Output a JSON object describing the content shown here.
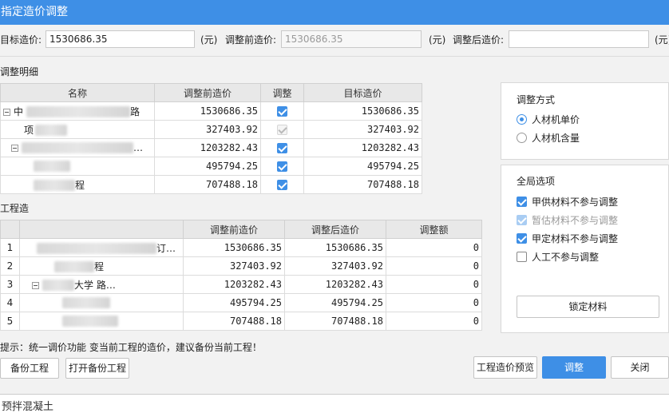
{
  "window": {
    "title": "指定造价调整"
  },
  "top": {
    "target_label": "目标造价:",
    "target_value": "1530686.35",
    "unit": "(元)",
    "before_label": "调整前造价:",
    "before_value": "1530686.35",
    "after_label": "调整后造价:",
    "after_value": ""
  },
  "detail": {
    "label": "调整明细",
    "headers": [
      "名称",
      "调整前造价",
      "调整",
      "目标造价"
    ],
    "rows": [
      {
        "name": "中",
        "name_tail": "路",
        "before": "1530686.35",
        "adjust": "on",
        "target": "1530686.35"
      },
      {
        "name": "项",
        "name_tail": "",
        "before": "327403.92",
        "adjust": "disabled",
        "target": "327403.92"
      },
      {
        "name": "",
        "name_tail": "…",
        "before": "1203282.43",
        "adjust": "on",
        "target": "1203282.43"
      },
      {
        "name": "",
        "name_tail": "",
        "before": "495794.25",
        "adjust": "on",
        "target": "495794.25"
      },
      {
        "name": "",
        "name_tail": "程",
        "before": "707488.18",
        "adjust": "on",
        "target": "707488.18"
      }
    ]
  },
  "project": {
    "label": "工程造",
    "headers": [
      "",
      "调整前造价",
      "调整后造价",
      "调整额"
    ],
    "rows": [
      {
        "num": "1",
        "name_tail": "订…",
        "before": "1530686.35",
        "after": "1530686.35",
        "diff": "0"
      },
      {
        "num": "2",
        "name_tail": "程",
        "before": "327403.92",
        "after": "327403.92",
        "diff": "0"
      },
      {
        "num": "3",
        "name_tail": "大学 路…",
        "before": "1203282.43",
        "after": "1203282.43",
        "diff": "0"
      },
      {
        "num": "4",
        "name_tail": "",
        "before": "495794.25",
        "after": "495794.25",
        "diff": "0"
      },
      {
        "num": "5",
        "name_tail": "",
        "before": "707488.18",
        "after": "707488.18",
        "diff": "0"
      }
    ]
  },
  "method": {
    "title": "调整方式",
    "options": [
      {
        "label": "人材机单价",
        "selected": true
      },
      {
        "label": "人材机含量",
        "selected": false
      }
    ]
  },
  "global": {
    "title": "全局选项",
    "options": [
      {
        "label": "甲供材料不参与调整",
        "state": "on"
      },
      {
        "label": "暂估材料不参与调整",
        "state": "soft"
      },
      {
        "label": "甲定材料不参与调整",
        "state": "on"
      },
      {
        "label": "人工不参与调整",
        "state": "off"
      }
    ],
    "lock_button": "锁定材料"
  },
  "tip": "提示：统一调价功能   变当前工程的造价，建议备份当前工程！",
  "buttons": {
    "backup": "备份工程",
    "open_backup": "打开备份工程",
    "preview": "工程造价预览",
    "adjust": "调整",
    "close": "关闭"
  },
  "background": {
    "text1": "",
    "text2": "预拌混凝土"
  }
}
